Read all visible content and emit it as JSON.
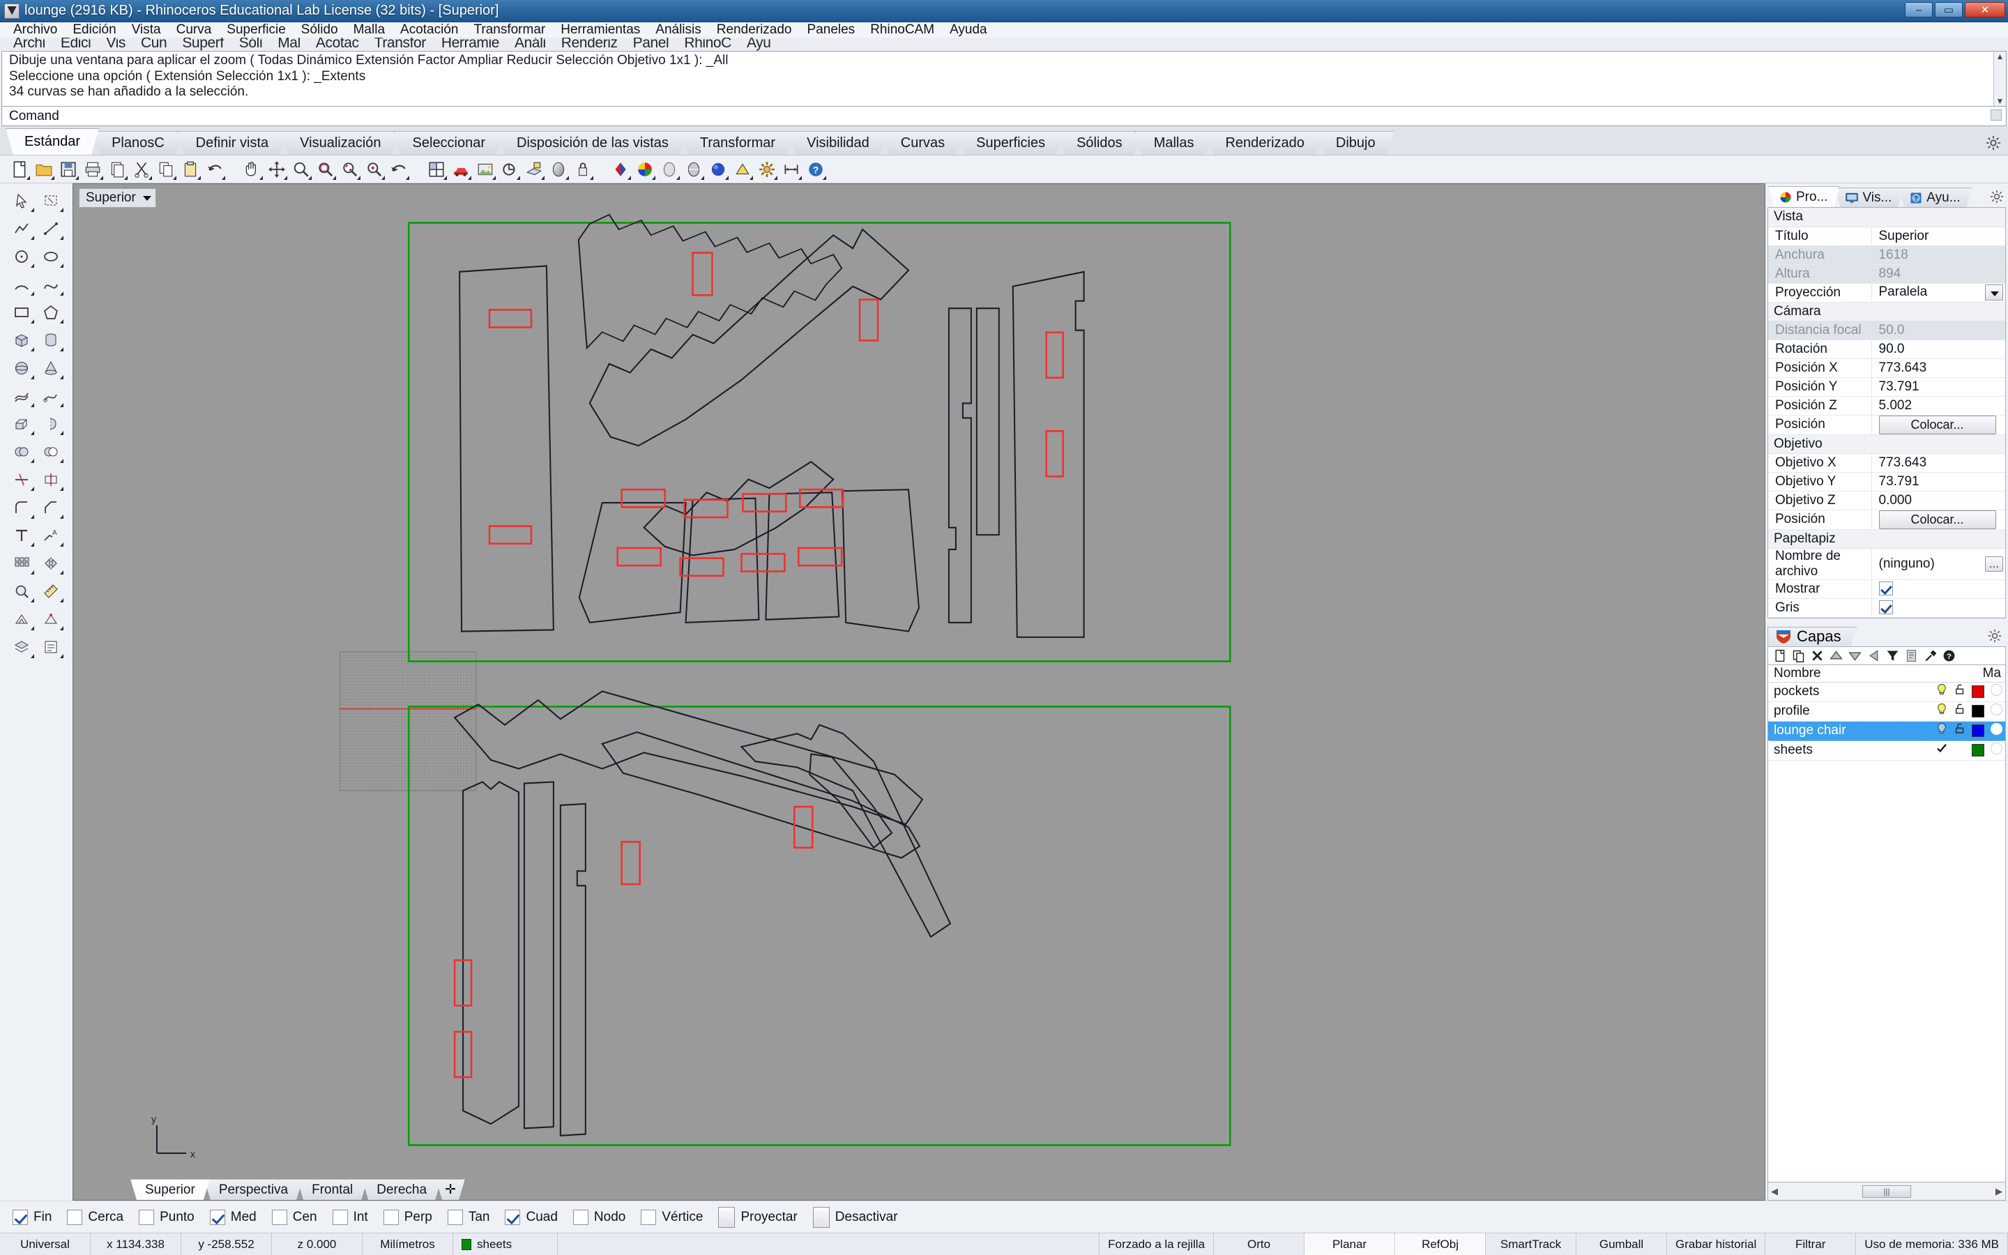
{
  "window": {
    "title": "lounge (2916 KB) - Rhinoceros Educational Lab License (32 bits) - [Superior]",
    "minimize": "–",
    "maximize": "▭",
    "close": "✕"
  },
  "menubar": {
    "items": [
      "Archivo",
      "Edición",
      "Vista",
      "Curva",
      "Superficie",
      "Sólido",
      "Malla",
      "Acotación",
      "Transformar",
      "Herramientas",
      "Análisis",
      "Renderizado",
      "Paneles",
      "RhinoCAM",
      "Ayuda"
    ],
    "items_back": [
      "Archi",
      "Edici",
      "Vis",
      "Cun",
      "Superf",
      "Sóli",
      "Mal",
      "Acotac",
      "Transfor",
      "Herramie",
      "Análi",
      "Renderiz",
      "Panel",
      "RhinoC",
      "Ayu"
    ]
  },
  "command": {
    "history": [
      "Dibuje una ventana para aplicar el zoom ( Todas  Dinámico  Extensión  Factor  Ampliar  Reducir  Selección  Objetivo  1x1 ): _All",
      "Seleccione una opción ( Extensión  Selección  1x1 ): _Extents",
      "34 curvas se han añadido a la selección."
    ],
    "prompt_label": "Comand",
    "scroll_up": "▲",
    "scroll_down": "▼"
  },
  "ribbon": {
    "tabs": [
      "Estándar",
      "PlanosC",
      "Definir vista",
      "Visualización",
      "Seleccionar",
      "Disposición de las vistas",
      "Transformar",
      "Visibilidad",
      "Curvas",
      "Superficies",
      "Sólidos",
      "Mallas",
      "Renderizado",
      "Dibujo"
    ],
    "active": "Estándar"
  },
  "toolbar": {
    "buttons": [
      "new-file-icon",
      "open-folder-icon",
      "save-icon",
      "print-icon",
      "copy-to-clipboard-icon",
      "cut-icon",
      "copy-icon",
      "paste-icon",
      "undo-icon",
      "pan-icon",
      "move-icon",
      "zoom-icon",
      "zoom-window-icon",
      "zoom-extents-icon",
      "zoom-selected-icon",
      "zoom-previous-icon",
      "viewport-layout-icon",
      "render-icon",
      "render-preview-icon",
      "rotate-view-icon",
      "set-cplane-icon",
      "shaded-icon",
      "lock-icon",
      "render-color-icon",
      "color-wheel-icon",
      "ghosted-icon",
      "xray-icon",
      "sphere-icon",
      "flat-shade-icon",
      "options-gear-icon",
      "dimension-icon",
      "help-icon"
    ]
  },
  "left_tools": {
    "rows": [
      [
        "arrow-select-icon",
        "select-window-icon"
      ],
      [
        "polyline-icon",
        "line-segment-icon"
      ],
      [
        "circle-icon",
        "ellipse-icon"
      ],
      [
        "arc-icon",
        "curve-icon"
      ],
      [
        "rectangle-icon",
        "polygon-icon"
      ],
      [
        "box-icon",
        "cylinder-icon"
      ],
      [
        "sphere-solid-icon",
        "cone-icon"
      ],
      [
        "surface-loft-icon",
        "sweep-icon"
      ],
      [
        "extrude-icon",
        "revolve-icon"
      ],
      [
        "boolean-union-icon",
        "boolean-diff-icon"
      ],
      [
        "trim-icon",
        "split-icon"
      ],
      [
        "fillet-icon",
        "chamfer-icon"
      ],
      [
        "text-icon",
        "leader-icon"
      ],
      [
        "array-icon",
        "mirror-icon"
      ],
      [
        "analyze-icon",
        "measure-icon"
      ],
      [
        "mesh-icon",
        "mesh-edit-icon"
      ],
      [
        "layer-tool-icon",
        "properties-icon"
      ]
    ]
  },
  "viewport": {
    "label": "Superior",
    "axis_y": "y",
    "axis_x": "x",
    "tabs": [
      "Superior",
      "Perspectiva",
      "Frontal",
      "Derecha"
    ],
    "active_tab": "Superior",
    "add_tab": "✛",
    "background": "#9a9a9a",
    "sheet_color": "#00a000",
    "pocket_color": "#ff2020",
    "profile_color": "#1b1b28"
  },
  "properties_panel": {
    "tabs": [
      {
        "label": "Pro...",
        "icon": "color-wheel-icon"
      },
      {
        "label": "Vis...",
        "icon": "monitor-icon"
      },
      {
        "label": "Ayu...",
        "icon": "help-book-icon"
      }
    ],
    "active_tab": "Pro...",
    "gear": "gear-icon",
    "groups": [
      {
        "name": "Vista",
        "rows": [
          {
            "key": "Título",
            "value": "Superior",
            "dim": false,
            "control": "text"
          },
          {
            "key": "Anchura",
            "value": "1618",
            "dim": true,
            "control": "text"
          },
          {
            "key": "Altura",
            "value": "894",
            "dim": true,
            "control": "text"
          },
          {
            "key": "Proyección",
            "value": "Paralela",
            "dim": false,
            "control": "dropdown"
          }
        ]
      },
      {
        "name": "Cámara",
        "rows": [
          {
            "key": "Distancia focal",
            "value": "50.0",
            "dim": true,
            "control": "text"
          },
          {
            "key": "Rotación",
            "value": "90.0",
            "dim": false,
            "control": "text"
          },
          {
            "key": "Posición X",
            "value": "773.643",
            "dim": false,
            "control": "text"
          },
          {
            "key": "Posición Y",
            "value": "73.791",
            "dim": false,
            "control": "text"
          },
          {
            "key": "Posición Z",
            "value": "5.002",
            "dim": false,
            "control": "text"
          },
          {
            "key": "Posición",
            "value": "Colocar...",
            "dim": false,
            "control": "button"
          }
        ]
      },
      {
        "name": "Objetivo",
        "rows": [
          {
            "key": "Objetivo X",
            "value": "773.643",
            "dim": false,
            "control": "text"
          },
          {
            "key": "Objetivo Y",
            "value": "73.791",
            "dim": false,
            "control": "text"
          },
          {
            "key": "Objetivo Z",
            "value": "0.000",
            "dim": false,
            "control": "text"
          },
          {
            "key": "Posición",
            "value": "Colocar...",
            "dim": false,
            "control": "button"
          }
        ]
      },
      {
        "name": "Papeltapiz",
        "rows": [
          {
            "key": "Nombre de archivo",
            "value": "(ninguno)",
            "dim": false,
            "control": "file"
          },
          {
            "key": "Mostrar",
            "value": "",
            "dim": false,
            "control": "checkbox",
            "checked": true
          },
          {
            "key": "Gris",
            "value": "",
            "dim": false,
            "control": "checkbox",
            "checked": true
          }
        ]
      }
    ]
  },
  "layers_panel": {
    "title": "Capas",
    "gear": "gear-icon",
    "tools": [
      "new-layer-icon",
      "copy-layer-icon",
      "delete-layer-icon",
      "move-up-icon",
      "move-down-icon",
      "move-left-icon",
      "filter-icon",
      "layer-props-icon",
      "tools-hammer-icon",
      "help-circle-icon"
    ],
    "columns": [
      "Nombre",
      "Ma"
    ],
    "rows": [
      {
        "name": "pockets",
        "on": true,
        "locked": false,
        "color": "#e00000",
        "current": false,
        "selected": false,
        "bulb": "#f2ef60"
      },
      {
        "name": "profile",
        "on": true,
        "locked": false,
        "color": "#000000",
        "current": false,
        "selected": false,
        "bulb": "#f2ef60"
      },
      {
        "name": "lounge chair",
        "on": true,
        "locked": false,
        "color": "#0000ee",
        "current": false,
        "selected": true,
        "bulb": "#9fd2f5"
      },
      {
        "name": "sheets",
        "on": true,
        "locked": false,
        "color": "#007d00",
        "current": true,
        "selected": false,
        "bulb": "#f2ef60"
      }
    ],
    "scroll_thumb": "|||"
  },
  "osnap": {
    "items": [
      {
        "label": "Fin",
        "checked": true
      },
      {
        "label": "Cerca",
        "checked": false
      },
      {
        "label": "Punto",
        "checked": false
      },
      {
        "label": "Med",
        "checked": true
      },
      {
        "label": "Cen",
        "checked": false
      },
      {
        "label": "Int",
        "checked": false
      },
      {
        "label": "Perp",
        "checked": false
      },
      {
        "label": "Tan",
        "checked": false
      },
      {
        "label": "Cuad",
        "checked": true
      },
      {
        "label": "Nodo",
        "checked": false
      },
      {
        "label": "Vértice",
        "checked": false
      },
      {
        "label": "Proyectar",
        "checked": false,
        "big": true
      },
      {
        "label": "Desactivar",
        "checked": false,
        "big": true
      }
    ]
  },
  "statusbar": {
    "cells": [
      {
        "text": "Universal",
        "type": "plain"
      },
      {
        "text": "x 1134.338",
        "type": "plain"
      },
      {
        "text": "y -258.552",
        "type": "plain"
      },
      {
        "text": "z 0.000",
        "type": "plain"
      },
      {
        "text": "Milímetros",
        "type": "plain"
      },
      {
        "text": "sheets",
        "type": "layer"
      },
      {
        "text": "",
        "type": "spacer"
      },
      {
        "text": "Forzado a la rejilla",
        "type": "plain"
      },
      {
        "text": "Orto",
        "type": "plain"
      },
      {
        "text": "Planar",
        "type": "pressed"
      },
      {
        "text": "RefObj",
        "type": "pressed"
      },
      {
        "text": "SmartTrack",
        "type": "plain"
      },
      {
        "text": "Gumball",
        "type": "plain"
      },
      {
        "text": "Grabar historial",
        "type": "plain"
      },
      {
        "text": "Filtrar",
        "type": "plain"
      },
      {
        "text": "Uso de memoria: 336 MB",
        "type": "plain"
      }
    ]
  }
}
